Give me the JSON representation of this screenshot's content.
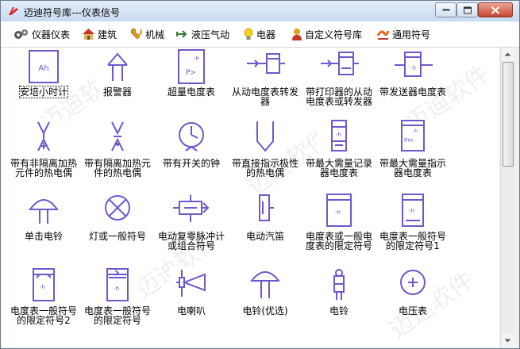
{
  "window": {
    "title": "迈迪符号库---仪表信号"
  },
  "toolbar": {
    "items": [
      {
        "label": "仪器仪表",
        "icon": "gears-icon"
      },
      {
        "label": "建筑",
        "icon": "building-icon"
      },
      {
        "label": "机械",
        "icon": "wrench-icon"
      },
      {
        "label": "液压气动",
        "icon": "hydraulic-arrow-icon"
      },
      {
        "label": "电器",
        "icon": "light-bulb-icon"
      },
      {
        "label": "自定义符号库",
        "icon": "user-icon"
      },
      {
        "label": "通用符号",
        "icon": "general-symbol-icon"
      }
    ]
  },
  "symbols": [
    {
      "label": "安培小时计",
      "selected": true
    },
    {
      "label": "报警器"
    },
    {
      "label": "超量电度表"
    },
    {
      "label": "从动电度表转发\n器"
    },
    {
      "label": "带打印器的从动\n电度表或转发器"
    },
    {
      "label": "带发送器电度表"
    },
    {
      "label": "带有非隔离加热\n元件的热电偶"
    },
    {
      "label": "带有隔离加热元\n件的热电偶"
    },
    {
      "label": "带有开关的钟"
    },
    {
      "label": "带直接指示极性\n的热电偶"
    },
    {
      "label": "带最大需量记录\n器电度表"
    },
    {
      "label": "带最大需量指示\n器电度表"
    },
    {
      "label": "单击电铃"
    },
    {
      "label": "灯或一般符号"
    },
    {
      "label": "电动复零脉冲计\n或组合符号"
    },
    {
      "label": "电动汽笛"
    },
    {
      "label": "电度表或一般电\n度表的限定符号"
    },
    {
      "label": "电度表一般符号\n的限定符号1"
    },
    {
      "label": "电度表一般符号\n的限定符号2"
    },
    {
      "label": "电度表一般符号\n的限定符号"
    },
    {
      "label": "电喇叭"
    },
    {
      "label": "电铃(优选)"
    },
    {
      "label": "电铃"
    },
    {
      "label": "电压表"
    }
  ],
  "watermark": {
    "text": "迈迪软件",
    "url": "http://www.52maidi.com"
  },
  "colors": {
    "symbol": "#6a5acd",
    "title_gradient_top": "#e4eefb",
    "close_button": "#c7442f"
  }
}
